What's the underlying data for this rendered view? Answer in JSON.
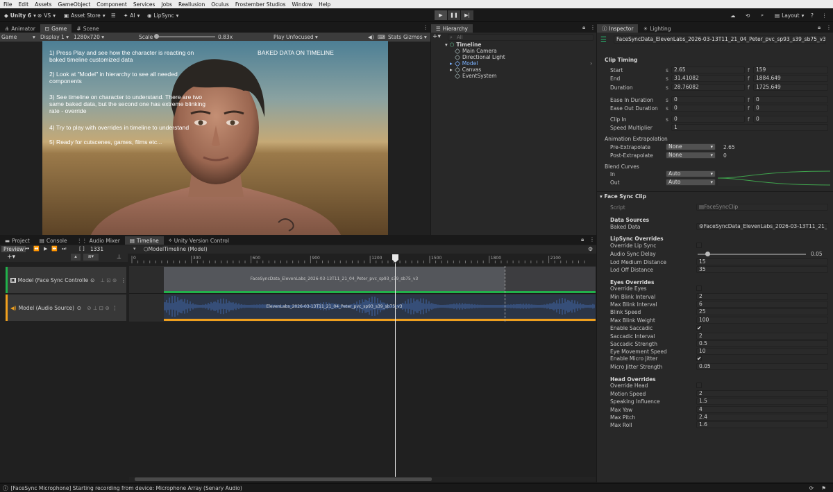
{
  "menubar": {
    "items": [
      "File",
      "Edit",
      "Assets",
      "GameObject",
      "Component",
      "Services",
      "Jobs",
      "Reallusion",
      "Oculus",
      "Frostember Studios",
      "Window",
      "Help"
    ]
  },
  "toolbar": {
    "unity_label": "Unity 6",
    "vs_label": "VS",
    "asset_store": "Asset Store",
    "ai_label": "AI",
    "lipsync": "LipSync",
    "layout": "Layout"
  },
  "game_panel": {
    "tabs": [
      "Animator",
      "Game",
      "Scene"
    ],
    "bar": {
      "mode": "Game",
      "display": "Display 1",
      "resolution": "1280x720",
      "scale_label": "Scale",
      "scale_value": "0.83x",
      "play_focus": "Play Unfocused",
      "stats": "Stats",
      "gizmos": "Gizmos"
    },
    "instructions": [
      "1) Press Play and see how the character is reacting on baked timeline customized data",
      "2) Look at \"Model\" in hierarchy to see all needed components",
      "3) See timeline on character to understand. There are two same baked data, but the second one has extreme blinking rate - override",
      "4) Try to play with overrides in timeline to understand",
      "5) Ready for cutscenes, games, films etc..."
    ],
    "banner": "BAKED DATA ON TIMELINE"
  },
  "hierarchy": {
    "tab": "Hierarchy",
    "search_placeholder": "All",
    "scene": "Timeline",
    "items": [
      "Main Camera",
      "Directional Light",
      "Model",
      "Canvas",
      "EventSystem"
    ]
  },
  "inspector": {
    "tabs": [
      "Inspector",
      "Lighting"
    ],
    "object_name": "FaceSyncData_ElevenLabs_2026-03-13T11_21_04_Peter_pvc_sp93_s39_sb75_v3",
    "clip_timing": {
      "title": "Clip Timing",
      "rows": [
        {
          "label": "Start",
          "s": "2.65",
          "f": "159"
        },
        {
          "label": "End",
          "s": "31.41082",
          "f": "1884.649"
        },
        {
          "label": "Duration",
          "s": "28.76082",
          "f": "1725.649"
        },
        {
          "label": "Ease In Duration",
          "s": "0",
          "f": "0"
        },
        {
          "label": "Ease Out Duration",
          "s": "0",
          "f": "0"
        },
        {
          "label": "Clip In",
          "s": "0",
          "f": "0"
        }
      ],
      "speed_label": "Speed Multiplier",
      "speed_value": "1"
    },
    "extrapolation": {
      "title": "Animation Extrapolation",
      "pre_label": "Pre-Extrapolate",
      "pre_value": "None",
      "pre_extra": "2.65",
      "post_label": "Post-Extrapolate",
      "post_value": "None",
      "post_extra": "0"
    },
    "blend": {
      "title": "Blend Curves",
      "in_label": "In",
      "in_value": "Auto",
      "out_label": "Out",
      "out_value": "Auto"
    },
    "face_sync": {
      "title": "Face Sync Clip",
      "script_label": "Script",
      "script_value": "FaceSyncClip",
      "data_sources": "Data Sources",
      "baked_label": "Baked Data",
      "baked_value": "FaceSyncData_ElevenLabs_2026-03-13T11_21_04_I",
      "lipsync_head": "LipSync Overrides",
      "lipsync_rows": [
        {
          "label": "Override Lip Sync",
          "type": "check",
          "value": ""
        },
        {
          "label": "Audio Sync Delay",
          "type": "slider",
          "value": "0.05"
        },
        {
          "label": "Lod Medium Distance",
          "type": "field",
          "value": "15"
        },
        {
          "label": "Lod Off Distance",
          "type": "field",
          "value": "35"
        }
      ],
      "eyes_head": "Eyes Overrides",
      "eyes_rows": [
        {
          "label": "Override Eyes",
          "type": "check",
          "value": ""
        },
        {
          "label": "Min Blink Interval",
          "type": "field",
          "value": "2"
        },
        {
          "label": "Max Blink Interval",
          "type": "field",
          "value": "6"
        },
        {
          "label": "Blink Speed",
          "type": "field",
          "value": "25"
        },
        {
          "label": "Max Blink Weight",
          "type": "field",
          "value": "100"
        },
        {
          "label": "Enable Saccadic",
          "type": "check",
          "value": "✔"
        },
        {
          "label": "Saccadic Interval",
          "type": "field",
          "value": "2"
        },
        {
          "label": "Saccadic Strength",
          "type": "field",
          "value": "0.5"
        },
        {
          "label": "Eye Movement Speed",
          "type": "field",
          "value": "10"
        },
        {
          "label": "Enable Micro Jitter",
          "type": "check",
          "value": "✔"
        },
        {
          "label": "Micro Jitter Strength",
          "type": "field",
          "value": "0.05"
        }
      ],
      "head_head": "Head Overrides",
      "head_rows": [
        {
          "label": "Override Head",
          "type": "check",
          "value": ""
        },
        {
          "label": "Motion Speed",
          "type": "field",
          "value": "2"
        },
        {
          "label": "Speaking Influence",
          "type": "field",
          "value": "1.5"
        },
        {
          "label": "Max Yaw",
          "type": "field",
          "value": "4"
        },
        {
          "label": "Max Pitch",
          "type": "field",
          "value": "2.4"
        },
        {
          "label": "Max Roll",
          "type": "field",
          "value": "1.6"
        }
      ]
    }
  },
  "bottom": {
    "tabs": [
      "Project",
      "Console",
      "Audio Mixer",
      "Timeline",
      "Unity Version Control"
    ],
    "preview": "Preview",
    "frame": "1331",
    "asset": "ModelTimeline (Model)",
    "ticks": [
      "0",
      "300",
      "600",
      "900",
      "1200",
      "1500",
      "1800",
      "2100"
    ],
    "tracks": [
      {
        "label": "Model (Face Sync Controlle",
        "clip": "FaceSyncData_ElevenLabs_2026-03-13T11_21_04_Peter_pvc_sp93_s39_sb75_v3",
        "color": "#21b14b"
      },
      {
        "label": "Model (Audio Source)",
        "clip": "ElevenLabs_2026-03-13T11_21_04_Peter_pvc_sp93_s39_sb75_v3",
        "color": "#f0a01e"
      }
    ]
  },
  "status": "[FaceSync Microphone] Starting recording from device: Microphone Array (Senary Audio)"
}
